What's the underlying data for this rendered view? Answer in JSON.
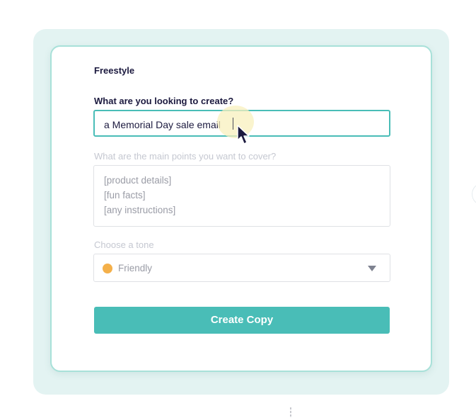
{
  "form": {
    "title": "Freestyle",
    "create_label": "What are you looking to create?",
    "create_value": "a Memorial Day sale email",
    "points_label": "What are the main points you want to cover?",
    "points_placeholder_lines": [
      "[product details]",
      "[fun facts]",
      "[any instructions]"
    ],
    "tone_label": "Choose a tone",
    "tone_value": "Friendly",
    "tone_icon": "emoji-face-icon",
    "submit_label": "Create Copy"
  },
  "colors": {
    "accent": "#49bdb7",
    "panel_bg": "#e3f3f2",
    "card_border": "#a8e1d9",
    "heading": "#1c1a3f",
    "muted_label": "#c5c8d1",
    "placeholder": "#9a9ca6",
    "tone_dot": "#f4b04a"
  }
}
